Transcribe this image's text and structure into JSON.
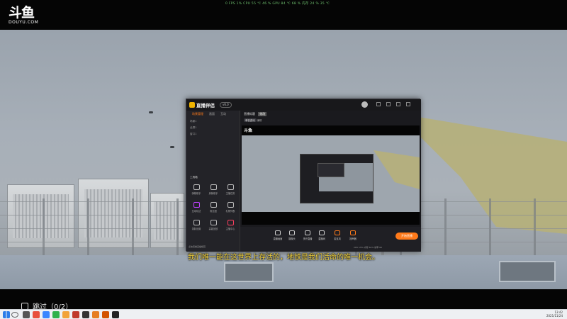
{
  "platform": {
    "logo_text": "斗鱼",
    "logo_sub": "DOUYU.COM"
  },
  "hud": {
    "text": "0  FPS    1%   CPU    55 ℃    46 %    GPU    84 ℃    68 %    内存    24 %    35 ℃"
  },
  "caption": {
    "text": "我们唯一能在这世界上存活的，地铁是我们活命的唯一机会。"
  },
  "skip": {
    "label": "跳过（0/2）"
  },
  "app": {
    "name": "直播伴侣",
    "version": "v6.0",
    "left_tabs": [
      "场景管理",
      "画面",
      "互动"
    ],
    "scenes": [
      "场景1",
      "全屏1",
      "窗口1"
    ],
    "tools_title": "工具箱",
    "tools": [
      "弹幕助手",
      "房管助手",
      "主播任务",
      "互动玩法",
      "粉丝团",
      "礼物列表",
      "录制设置",
      "高能回放",
      "主播中心"
    ],
    "live_title": "直播标题",
    "live_title_btn": "修改",
    "category": "单机游戏",
    "category_edit": "编辑",
    "controls": [
      "直播画面",
      "摄像头",
      "多开直播",
      "直播间",
      "麦克风",
      "扬声器"
    ],
    "go_live": "开始直播",
    "status": "CPU 15%  内存 62%  帧率 60",
    "footer": "点击查看直播规范"
  },
  "colors": {
    "accent": "#ff7a1a",
    "caption": "#f3d23b",
    "brand_yellow": "#f0b400"
  },
  "tray": {
    "time": "13:42",
    "date": "2021/11/24"
  },
  "icons": [
    "logo-icon",
    "skip-icon",
    "windows-start-icon",
    "search-icon",
    "avatar-icon"
  ]
}
